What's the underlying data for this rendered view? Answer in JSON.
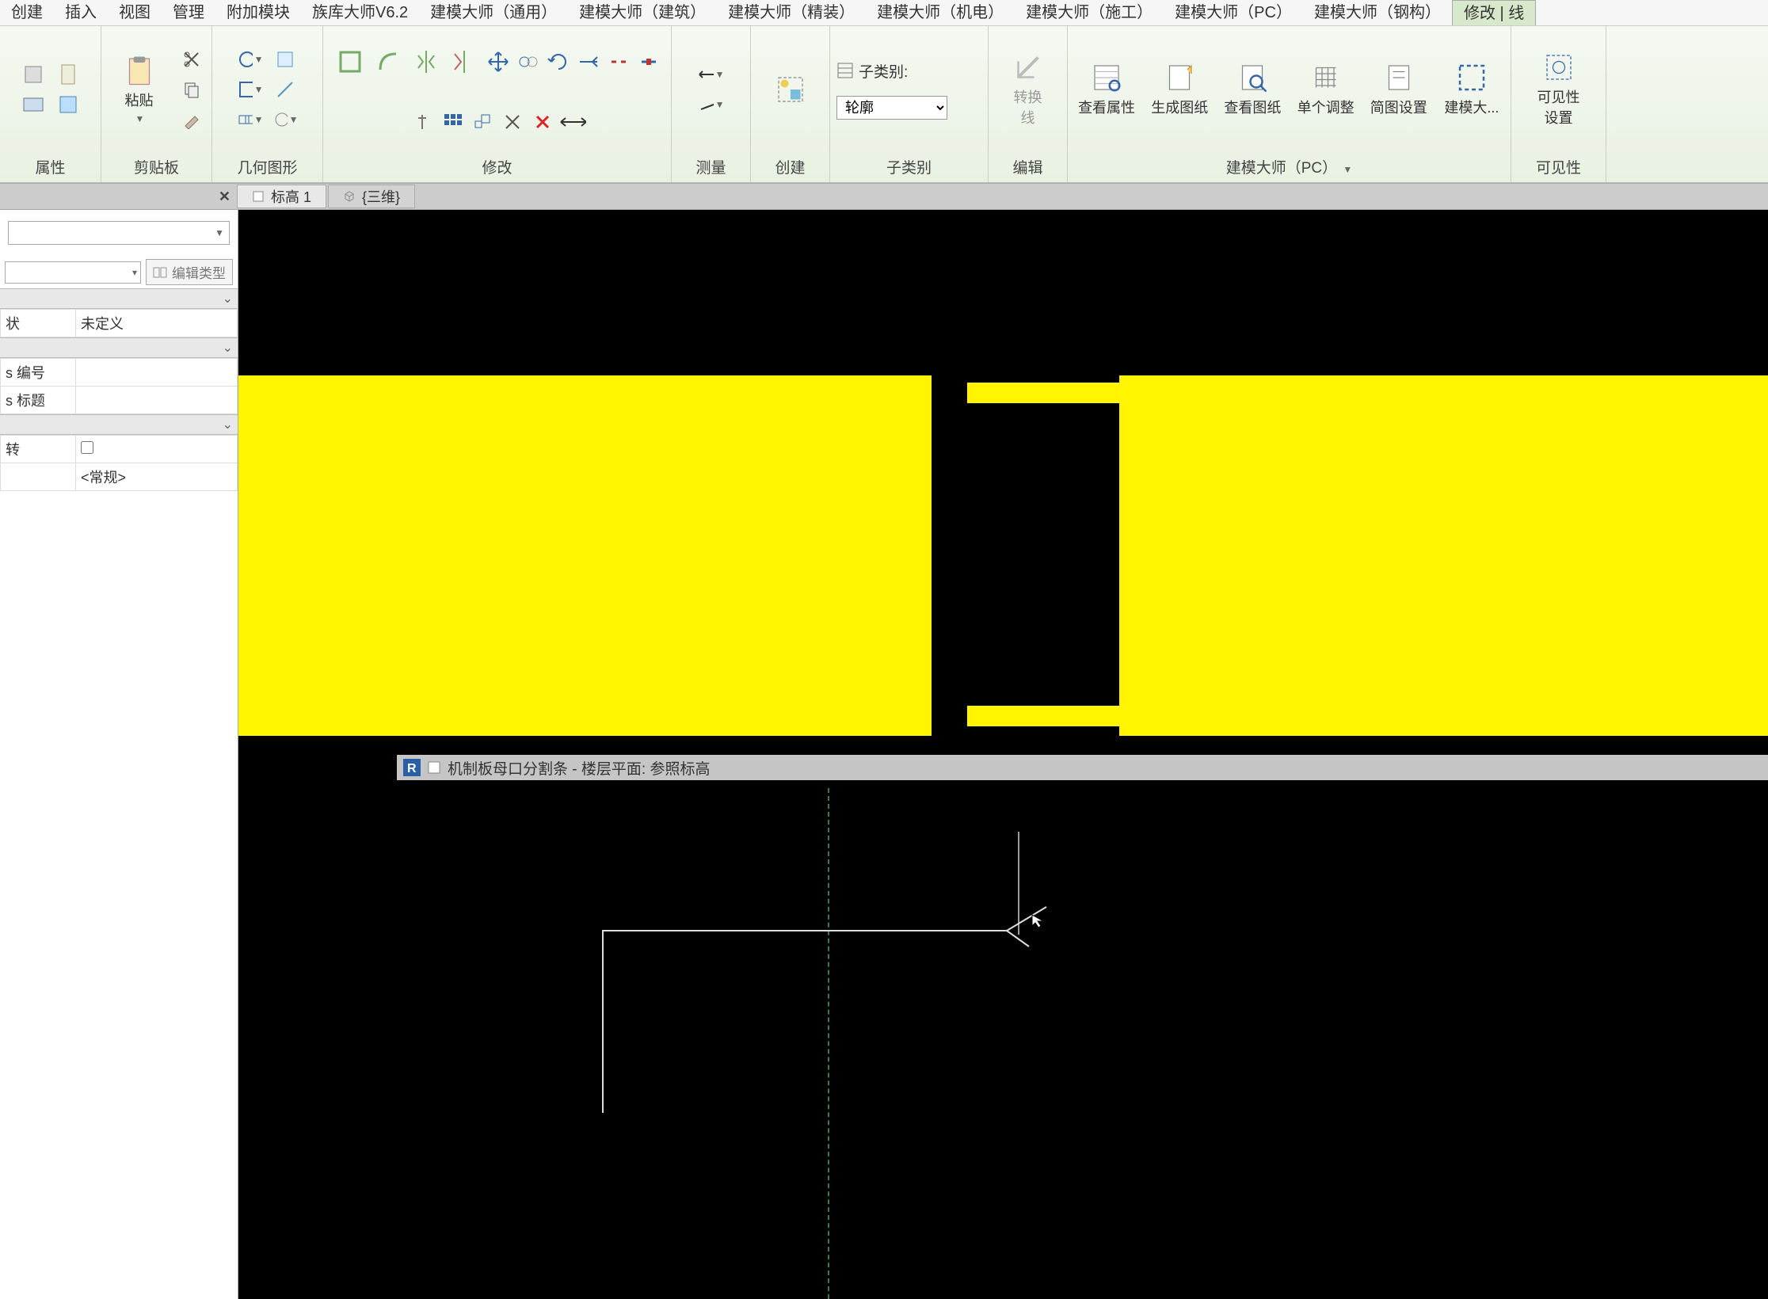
{
  "menubar": {
    "tabs": [
      "创建",
      "插入",
      "视图",
      "管理",
      "附加模块",
      "族库大师V6.2",
      "建模大师（通用）",
      "建模大师（建筑）",
      "建模大师（精装）",
      "建模大师（机电）",
      "建模大师（施工）",
      "建模大师（PC）",
      "建模大师（钢构）",
      "修改 | 线"
    ]
  },
  "ribbon": {
    "panels": {
      "properties": "属性",
      "clipboard": "剪贴板",
      "geometry": "几何图形",
      "modify": "修改",
      "measure": "测量",
      "create": "创建",
      "subcategory": "子类别",
      "edit": "编辑",
      "jmds": "建模大师（PC）",
      "visibility": "可见性"
    },
    "paste_label": "粘贴",
    "subcat_label": "子类别:",
    "subcat_value": "轮廓",
    "convert_line_label": "转换\n线",
    "view_prop": "查看属性",
    "gen_sheet": "生成图纸",
    "view_sheet": "查看图纸",
    "single_adj": "单个调整",
    "profile_set": "简图设置",
    "jmds_btn": "建模大...",
    "visibility_btn": "可见性\n设置"
  },
  "viewtabs": {
    "tab1": "标高 1",
    "tab2": "{三维}"
  },
  "properties_panel": {
    "edit_type": "编辑类型",
    "state_lab": "状",
    "state_val": "未定义",
    "num_lab": "s 编号",
    "title_lab": "s 标题",
    "rot_lab": "转",
    "common_val": "<常规>"
  },
  "floatwin": {
    "title": "机制板母口分割条 - 楼层平面: 参照标高"
  }
}
